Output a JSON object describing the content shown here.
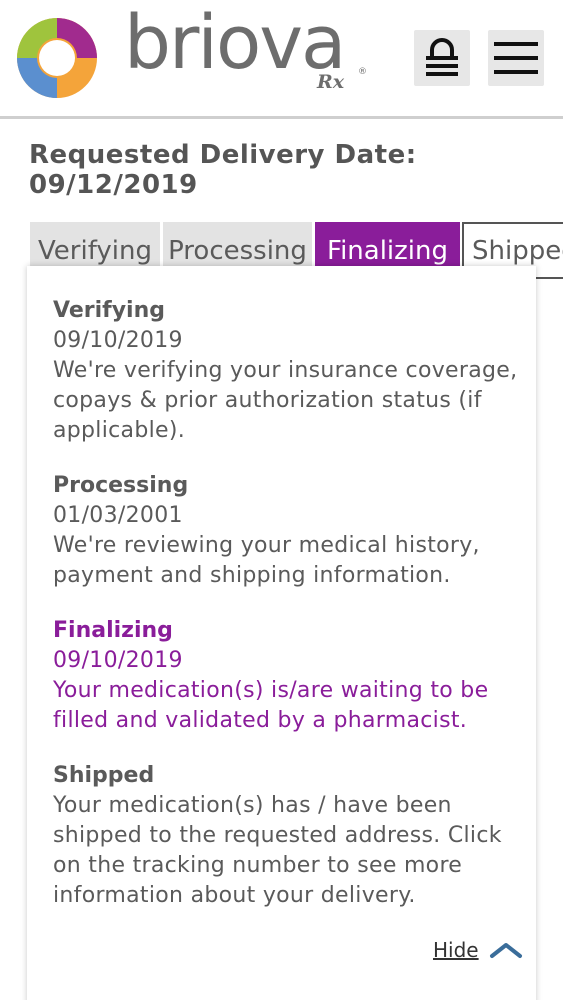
{
  "header": {
    "logo_text": "briova",
    "logo_rx": "Rx",
    "logo_reg": "®",
    "lock_icon": "lock-icon",
    "menu_icon": "hamburger-menu-icon"
  },
  "delivery": {
    "label": "Requested Delivery Date: 09/12/2019"
  },
  "tabs": [
    {
      "label": "Verifying",
      "active": false
    },
    {
      "label": "Processing",
      "active": false
    },
    {
      "label": "Finalizing",
      "active": true
    },
    {
      "label": "Shipped",
      "active": false
    }
  ],
  "steps": [
    {
      "title": "Verifying",
      "date": "09/10/2019",
      "description": "We're verifying your insurance coverage, copays & prior authorization status (if applicable).",
      "active": false
    },
    {
      "title": "Processing",
      "date": "01/03/2001",
      "description": "We're reviewing your medical history, payment and shipping information.",
      "active": false
    },
    {
      "title": "Finalizing",
      "date": "09/10/2019",
      "description": "Your medication(s) is/are waiting to be filled and validated by a pharmacist.",
      "active": true
    },
    {
      "title": "Shipped",
      "date": "",
      "description": "Your medication(s) has / have been shipped to the requested address. Click on the tracking number to see more information about your delivery.",
      "active": false
    }
  ],
  "hide": {
    "label": "Hide",
    "icon": "chevron-up-icon"
  },
  "colors": {
    "accent_purple": "#8a1d9a",
    "tab_inactive": "#e3e3e3",
    "text_gray": "#5a5a5a",
    "chevron_blue": "#3a6d9a"
  }
}
